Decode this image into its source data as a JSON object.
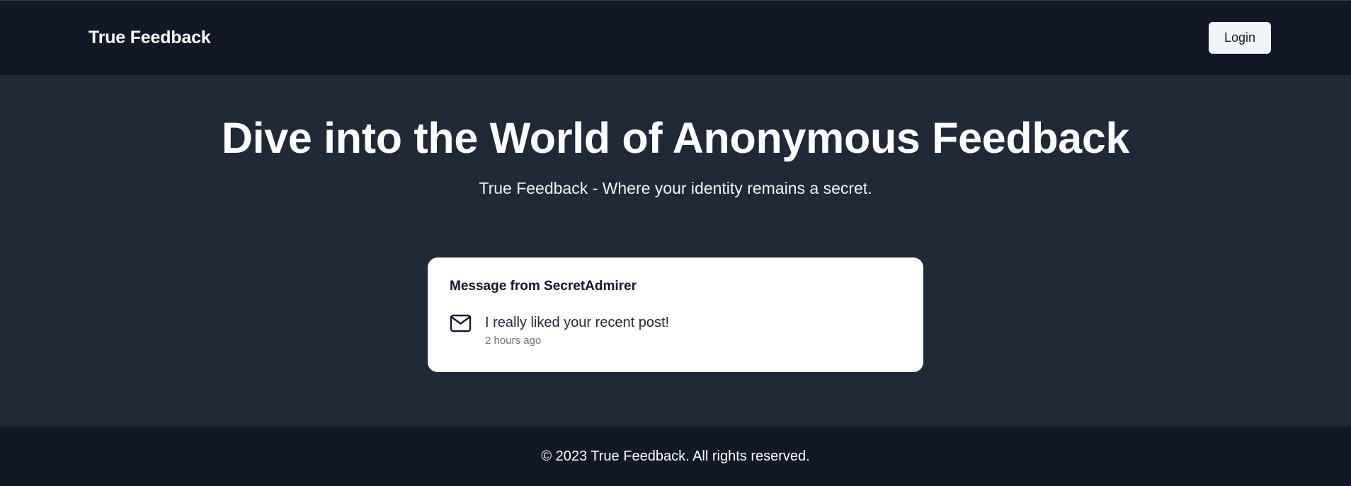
{
  "navbar": {
    "brand": "True Feedback",
    "login_label": "Login"
  },
  "hero": {
    "title": "Dive into the World of Anonymous Feedback",
    "subtitle": "True Feedback - Where your identity remains a secret."
  },
  "message_card": {
    "title": "Message from SecretAdmirer",
    "icon": "mail-icon",
    "content": "I really liked your recent post!",
    "time": "2 hours ago"
  },
  "footer": {
    "text": "© 2023 True Feedback. All rights reserved."
  },
  "colors": {
    "navbar_bg": "#111827",
    "main_bg": "#1f2937",
    "card_bg": "#ffffff",
    "button_bg": "#f1f5f9"
  }
}
